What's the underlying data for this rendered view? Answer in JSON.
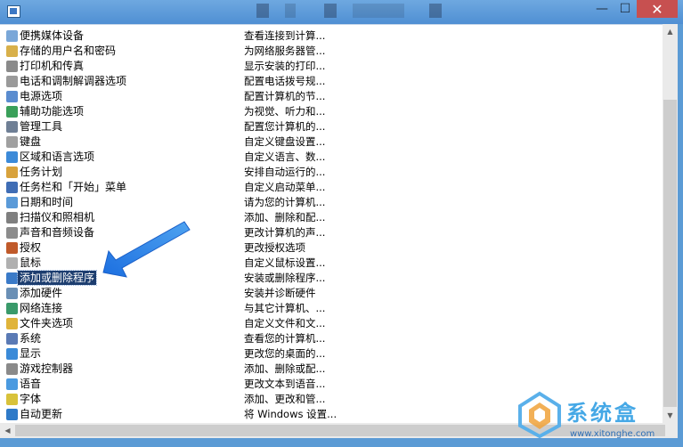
{
  "window": {
    "minimize_glyph": "—",
    "maximize_glyph": "☐",
    "close_glyph": "✕"
  },
  "items": [
    {
      "name": "便携媒体设备",
      "desc": "查看连接到计算...",
      "icon": "portable-device-icon",
      "color": "#7aa7d8"
    },
    {
      "name": "存储的用户名和密码",
      "desc": "为网络服务器管...",
      "icon": "credential-icon",
      "color": "#d8b04a"
    },
    {
      "name": "打印机和传真",
      "desc": "显示安装的打印...",
      "icon": "printer-icon",
      "color": "#8a8a8a"
    },
    {
      "name": "电话和调制解调器选项",
      "desc": "配置电话拨号规...",
      "icon": "phone-icon",
      "color": "#9a9a9a"
    },
    {
      "name": "电源选项",
      "desc": "配置计算机的节...",
      "icon": "power-icon",
      "color": "#5a8ccf"
    },
    {
      "name": "辅助功能选项",
      "desc": "为视觉、听力和...",
      "icon": "accessibility-icon",
      "color": "#3aa05a"
    },
    {
      "name": "管理工具",
      "desc": "配置您计算机的...",
      "icon": "admin-tools-icon",
      "color": "#6f7f95"
    },
    {
      "name": "键盘",
      "desc": "自定义键盘设置...",
      "icon": "keyboard-icon",
      "color": "#a0a0a0"
    },
    {
      "name": "区域和语言选项",
      "desc": "自定义语言、数...",
      "icon": "globe-icon",
      "color": "#3c8ad8"
    },
    {
      "name": "任务计划",
      "desc": "安排自动运行的...",
      "icon": "task-scheduler-icon",
      "color": "#d8a23c"
    },
    {
      "name": "任务栏和「开始」菜单",
      "desc": "自定义启动菜单...",
      "icon": "taskbar-icon",
      "color": "#3f6db5"
    },
    {
      "name": "日期和时间",
      "desc": "请为您的计算机...",
      "icon": "clock-icon",
      "color": "#5a9ad8"
    },
    {
      "name": "扫描仪和照相机",
      "desc": "添加、删除和配...",
      "icon": "scanner-icon",
      "color": "#7f7f7f"
    },
    {
      "name": "声音和音频设备",
      "desc": "更改计算机的声...",
      "icon": "speaker-icon",
      "color": "#8c8c8c"
    },
    {
      "name": "授权",
      "desc": "更改授权选项",
      "icon": "license-icon",
      "color": "#c05a2a"
    },
    {
      "name": "鼠标",
      "desc": "自定义鼠标设置...",
      "icon": "mouse-icon",
      "color": "#b0b0b0"
    },
    {
      "name": "添加或删除程序",
      "desc": "安装或删除程序...",
      "icon": "add-remove-programs-icon",
      "color": "#3a7ac8",
      "selected": true
    },
    {
      "name": "添加硬件",
      "desc": "安装并诊断硬件",
      "icon": "hardware-icon",
      "color": "#6a8fb5"
    },
    {
      "name": "网络连接",
      "desc": "与其它计算机、...",
      "icon": "network-icon",
      "color": "#3a9a6a"
    },
    {
      "name": "文件夹选项",
      "desc": "自定义文件和文...",
      "icon": "folder-icon",
      "color": "#e0b43a"
    },
    {
      "name": "系统",
      "desc": "查看您的计算机...",
      "icon": "system-icon",
      "color": "#5a7ab5"
    },
    {
      "name": "显示",
      "desc": "更改您的桌面的...",
      "icon": "display-icon",
      "color": "#3a8ad8"
    },
    {
      "name": "游戏控制器",
      "desc": "添加、删除或配...",
      "icon": "gamepad-icon",
      "color": "#8a8a8a"
    },
    {
      "name": "语音",
      "desc": "更改文本到语音...",
      "icon": "speech-icon",
      "color": "#4a9ae0"
    },
    {
      "name": "字体",
      "desc": "添加、更改和管...",
      "icon": "font-icon",
      "color": "#d8c23a"
    },
    {
      "name": "自动更新",
      "desc": "将 Windows 设置...",
      "icon": "update-icon",
      "color": "#2f7ac8"
    }
  ],
  "watermark": {
    "text": "系统盒",
    "url": "www.xitonghe.com"
  }
}
